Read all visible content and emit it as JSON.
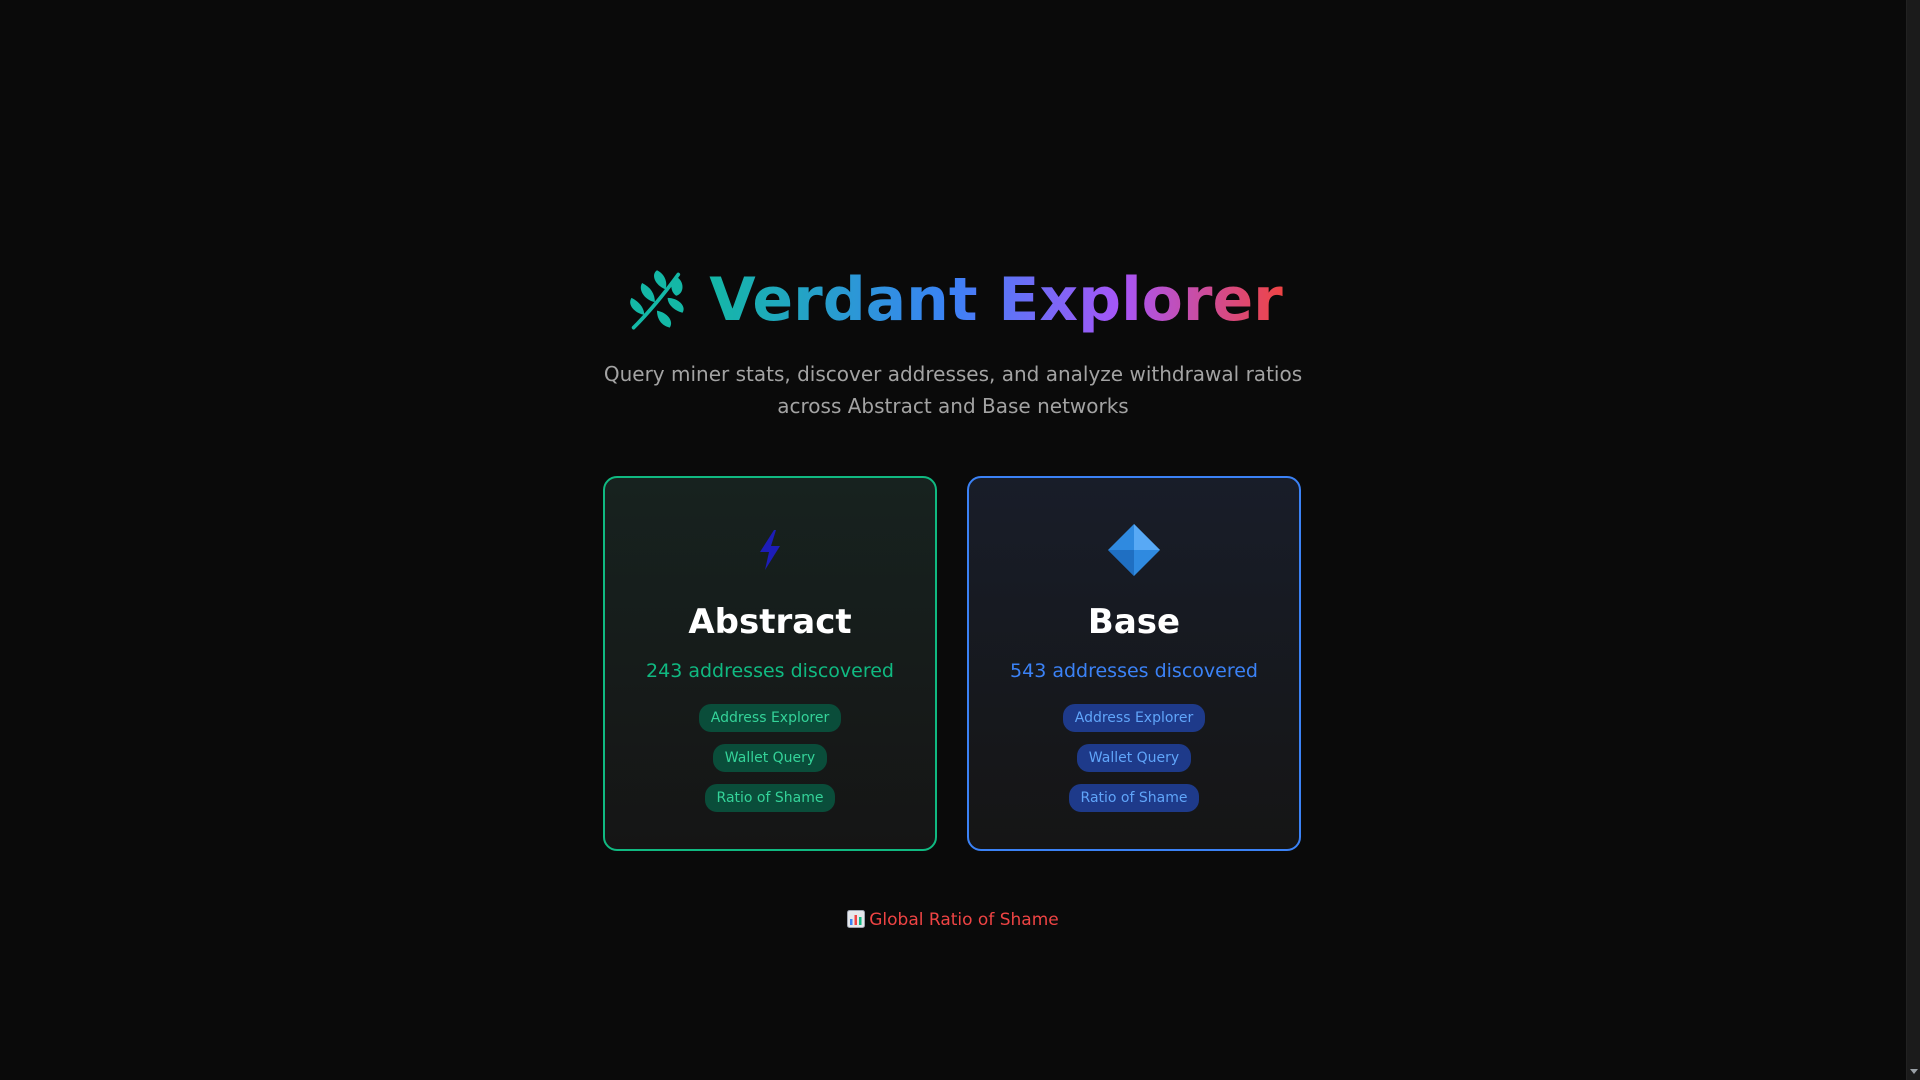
{
  "header": {
    "title": "Verdant Explorer",
    "title_icon": "leaf-icon",
    "subtitle": "Query miner stats, discover addresses, and analyze withdrawal ratios across Abstract and Base networks"
  },
  "networks": [
    {
      "name": "Abstract",
      "icon": "lightning-icon",
      "count_text": "243 addresses discovered",
      "accent": "#10b981",
      "links": [
        "Address Explorer",
        "Wallet Query",
        "Ratio of Shame"
      ]
    },
    {
      "name": "Base",
      "icon": "blue-diamond-icon",
      "count_text": "543 addresses discovered",
      "accent": "#3b82f6",
      "links": [
        "Address Explorer",
        "Wallet Query",
        "Ratio of Shame"
      ]
    }
  ],
  "footer": {
    "global_link": "Global Ratio of Shame",
    "global_link_icon": "bar-chart-icon",
    "accent": "#ef4444"
  }
}
